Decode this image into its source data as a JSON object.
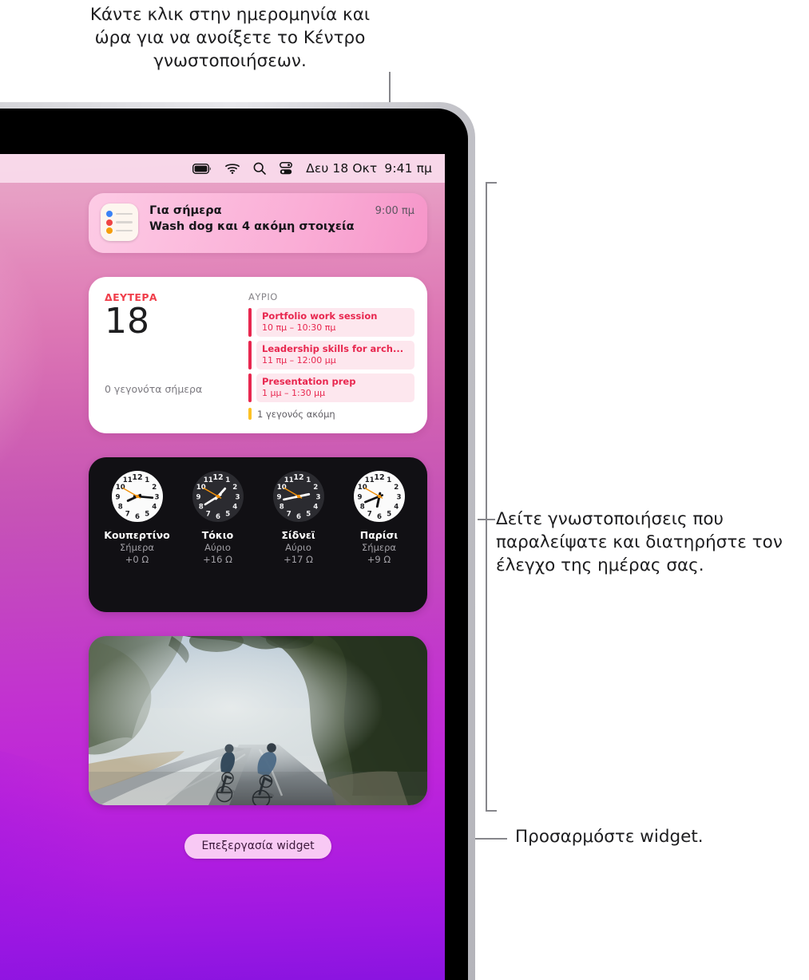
{
  "callouts": {
    "top": "Κάντε κλικ στην ημερομηνία και ώρα για να ανοίξετε το Κέντρο γνωστοποιήσεων.",
    "right": "Δείτε γνωστοποιήσεις που παραλείψατε και διατηρήστε τον έλεγχο της ημέρας σας.",
    "bottom": "Προσαρμόστε widget."
  },
  "menubar": {
    "icons": [
      "battery-icon",
      "wifi-icon",
      "search-icon",
      "control-center-icon"
    ],
    "date": "Δευ 18 Οκτ",
    "time": "9:41 πμ"
  },
  "notification": {
    "app_icon": "reminders-icon",
    "title": "Για σήμερα",
    "subtitle": "Wash dog και 4 ακόμη στοιχεία",
    "time": "9:00 πμ",
    "dot_colors": [
      "#3a82f6",
      "#ef4444",
      "#f59e0b"
    ]
  },
  "calendar": {
    "day_name": "ΔΕΥΤΕΡΑ",
    "day_number": "18",
    "no_events": "0 γεγονότα σήμερα",
    "tomorrow_label": "ΑΥΡΙΟ",
    "accent": "#e8274f",
    "events": [
      {
        "title": "Portfolio work session",
        "time": "10 πμ – 10:30 πμ"
      },
      {
        "title": "Leadership skills for arch...",
        "time": "11 πμ – 12:00 μμ"
      },
      {
        "title": "Presentation prep",
        "time": "1 μμ – 1:30 μμ"
      }
    ],
    "more_events": "1 γεγονός ακόμη",
    "more_color": "#fcc125"
  },
  "world_clock": {
    "clocks": [
      {
        "city": "Κουπερτίνο",
        "day": "Σήμερα",
        "offset": "+0 Ω",
        "theme": "light",
        "hour_deg": 245,
        "minute_deg": 95,
        "second_deg": 300
      },
      {
        "city": "Τόκιο",
        "day": "Αύριο",
        "offset": "+16 Ω",
        "theme": "dark",
        "hour_deg": 42,
        "minute_deg": 238,
        "second_deg": 300
      },
      {
        "city": "Σίδνεϊ",
        "day": "Αύριο",
        "offset": "+17 Ω",
        "theme": "dark",
        "hour_deg": 78,
        "minute_deg": 258,
        "second_deg": 300
      },
      {
        "city": "Παρίσι",
        "day": "Σήμερα",
        "offset": "+9 Ω",
        "theme": "light",
        "hour_deg": 192,
        "minute_deg": 248,
        "second_deg": 300
      }
    ],
    "numerals": [
      "12",
      "1",
      "2",
      "3",
      "4",
      "5",
      "6",
      "7",
      "8",
      "9",
      "10",
      "11"
    ],
    "second_hand_color": "#f2920c"
  },
  "photo_widget": {
    "alt": "Two cyclists riding on a foggy forest road"
  },
  "edit_widgets_button": "Επεξεργασία widget"
}
